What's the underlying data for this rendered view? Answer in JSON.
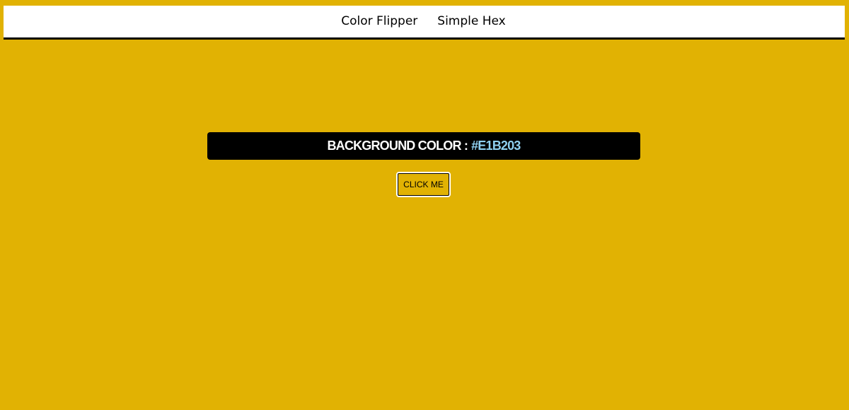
{
  "nav": {
    "items": [
      {
        "label": "Color Flipper"
      },
      {
        "label": "Simple Hex"
      }
    ]
  },
  "banner": {
    "label": "BACKGROUND COLOR :",
    "hex": "#E1B203"
  },
  "button": {
    "label": "CLICK ME"
  },
  "colors": {
    "background": "#E1B203",
    "banner_bg": "#000000",
    "hex_text": "#8FD0F0",
    "nav_bg": "#FFFFFF"
  }
}
